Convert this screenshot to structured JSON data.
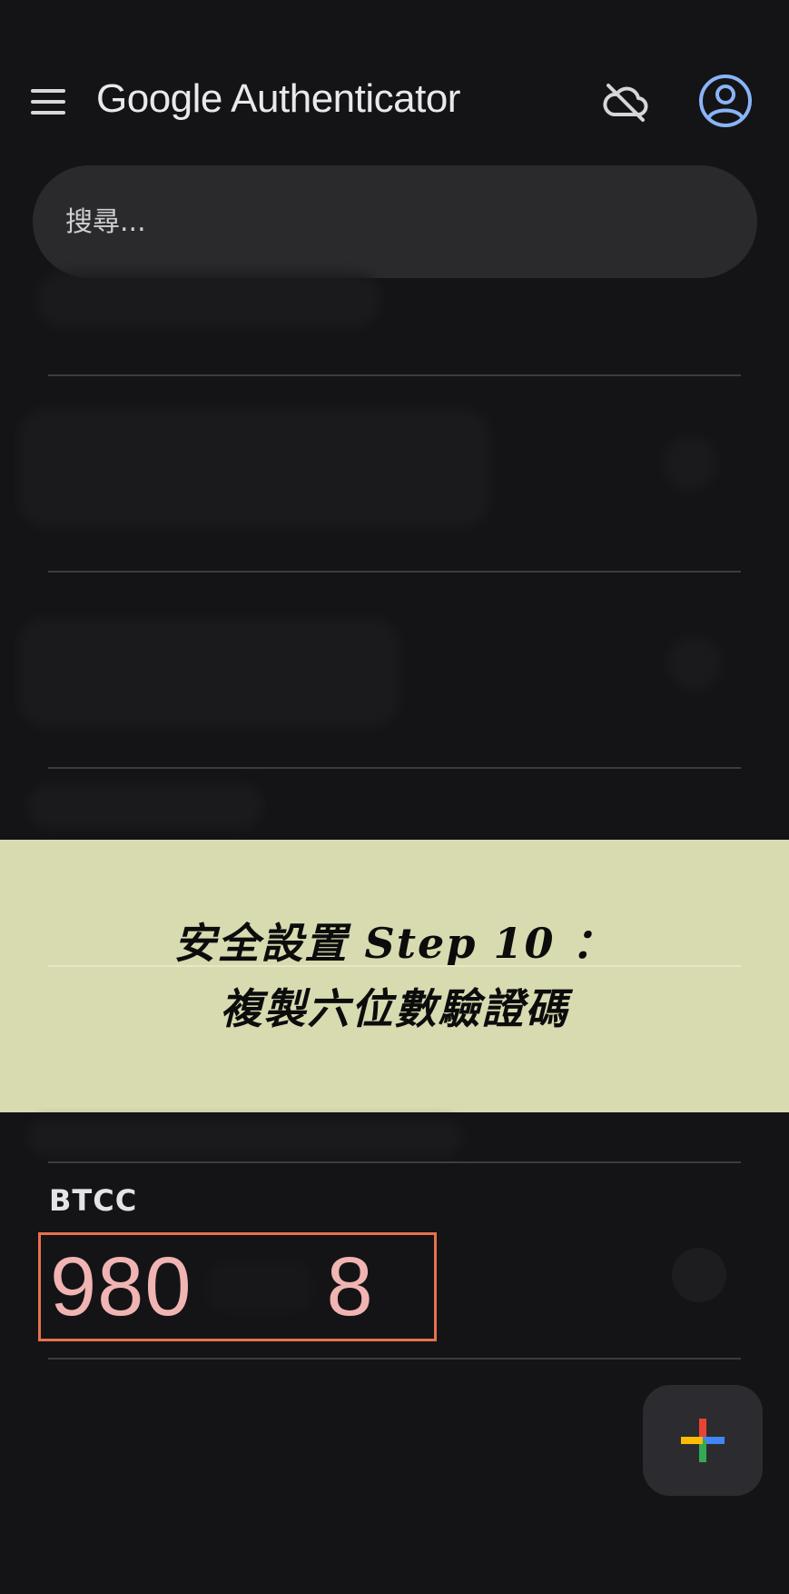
{
  "header": {
    "title": "Google Authenticator",
    "menu_icon": "hamburger-menu-icon",
    "sync_icon": "cloud-off-icon",
    "account_icon": "account-circle-icon",
    "account_color": "#8ab4f8"
  },
  "search": {
    "placeholder": "搜尋..."
  },
  "banner": {
    "line1": "安全設置 Step 10 ：",
    "line2": "複製六位數驗證碼",
    "background": "#d8dbb0"
  },
  "entry": {
    "issuer": "BTCC",
    "code_visible_start": "980",
    "code_visible_end": "8",
    "code_color": "#f0b4b2",
    "highlight_color": "#e8714f"
  },
  "fab": {
    "icon": "google-plus-icon",
    "colors": [
      "#ea4335",
      "#4285f4",
      "#34a853",
      "#fbbc04"
    ]
  }
}
